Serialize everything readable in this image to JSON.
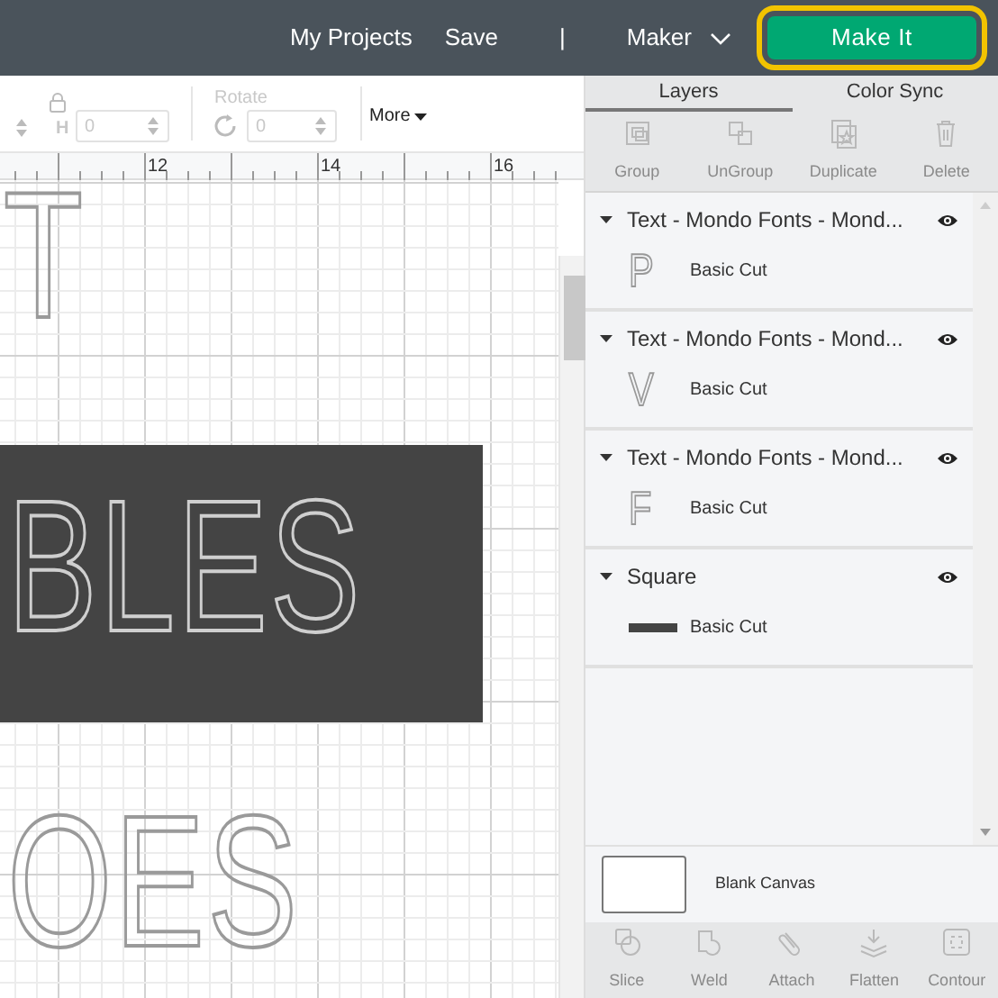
{
  "top_bar": {
    "links": [
      "My Projects",
      "Save"
    ],
    "separator": "|",
    "machine": "Maker",
    "make_button": "Make It"
  },
  "toolbar": {
    "h_label": "H",
    "h_value": "0",
    "rotate_label": "Rotate",
    "rotate_value": "0",
    "more": "More"
  },
  "ruler": {
    "labels": [
      "12",
      "14",
      "16"
    ]
  },
  "canvas": {
    "texts": [
      {
        "text": "T",
        "kind": "outline"
      },
      {
        "text": "BLES",
        "kind": "on-dark"
      },
      {
        "text": "OES",
        "kind": "outline"
      }
    ]
  },
  "panel": {
    "tabs": [
      {
        "label": "Layers",
        "selected": true
      },
      {
        "label": "Color Sync",
        "selected": false
      }
    ],
    "actions": [
      {
        "label": "Group",
        "kind": "group",
        "disabled": true
      },
      {
        "label": "UnGroup",
        "kind": "ungroup",
        "disabled": true
      },
      {
        "label": "Duplicate",
        "kind": "duplicate",
        "disabled": true
      },
      {
        "label": "Delete",
        "kind": "delete",
        "disabled": true
      }
    ],
    "layers": [
      {
        "title": "Text - Mondo Fonts - Mond...",
        "expanded": true,
        "visible": true,
        "kind": "letter",
        "thumb": "P",
        "operation": "Basic Cut"
      },
      {
        "title": "Text - Mondo Fonts - Mond...",
        "expanded": true,
        "visible": true,
        "kind": "letter",
        "thumb": "V",
        "operation": "Basic Cut"
      },
      {
        "title": "Text - Mondo Fonts - Mond...",
        "expanded": true,
        "visible": true,
        "kind": "letter",
        "thumb": "F",
        "operation": "Basic Cut"
      },
      {
        "title": "Square",
        "expanded": true,
        "visible": true,
        "kind": "shape",
        "operation": "Basic Cut"
      }
    ],
    "canvas_label": "Blank Canvas",
    "bottom_actions": [
      {
        "label": "Slice",
        "kind": "slice",
        "disabled": true
      },
      {
        "label": "Weld",
        "kind": "weld",
        "disabled": true
      },
      {
        "label": "Attach",
        "kind": "attach",
        "disabled": true
      },
      {
        "label": "Flatten",
        "kind": "flatten",
        "disabled": true
      },
      {
        "label": "Contour",
        "kind": "contour",
        "disabled": true
      }
    ]
  }
}
